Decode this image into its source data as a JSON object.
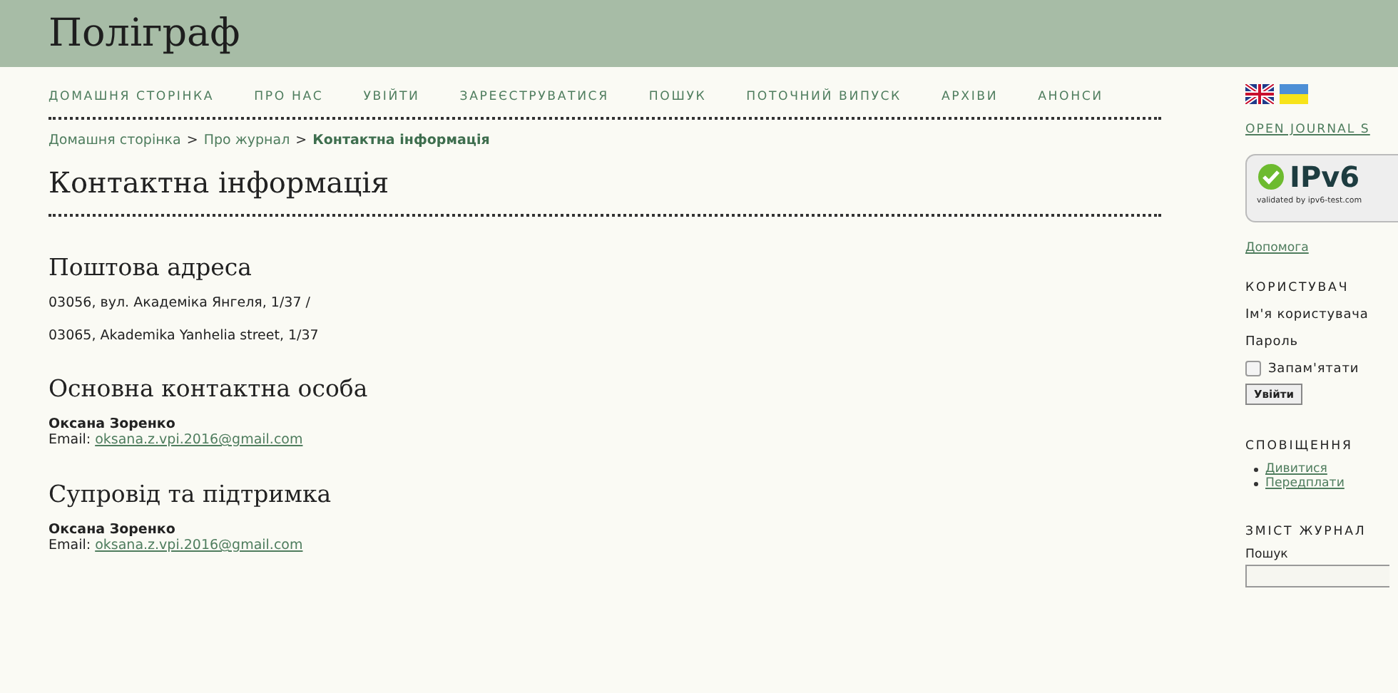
{
  "site_title": "Поліграф",
  "nav": [
    "ДОМАШНЯ СТОРІНКА",
    "ПРО НАС",
    "УВІЙТИ",
    "ЗАРЕЄСТРУВАТИСЯ",
    "ПОШУК",
    "ПОТОЧНИЙ ВИПУСК",
    "АРХІВИ",
    "АНОНСИ"
  ],
  "breadcrumb": [
    {
      "label": "Домашня сторінка",
      "current": false
    },
    {
      "label": "Про журнал",
      "current": false
    },
    {
      "label": "Контактна інформація",
      "current": true
    }
  ],
  "breadcrumb_separator": ">",
  "page_title": "Контактна інформація",
  "sections": [
    {
      "kind": "address",
      "heading": "Поштова адреса",
      "lines": [
        "03056, вул. Академіка Янгеля, 1/37 /",
        "03065, Akademika Yanhelia street, 1/37"
      ]
    },
    {
      "kind": "contact",
      "heading": "Основна контактна особа",
      "name": "Оксана Зоренко",
      "email_label": "Email:",
      "email": "oksana.z.vpi.2016@gmail.com"
    },
    {
      "kind": "contact",
      "heading": "Супровід та підтримка",
      "name": "Оксана Зоренко",
      "email_label": "Email:",
      "email": "oksana.z.vpi.2016@gmail.com"
    }
  ],
  "sidebar": {
    "ojs_link": "OPEN JOURNAL S",
    "badge": {
      "title": "IPv6",
      "caption": "validated by ipv6-test.com"
    },
    "help_link": "Допомога",
    "user": {
      "heading": "КОРИСТУВАЧ",
      "username_label": "Ім'я користувача",
      "password_label": "Пароль",
      "remember_label": "Запам'ятати",
      "remember_checked": false,
      "login_button": "Увійти"
    },
    "notifications": {
      "heading": "СПОВІЩЕННЯ",
      "links": [
        "Дивитися",
        "Передплати"
      ]
    },
    "journal_content": {
      "heading": "ЗМІСТ ЖУРНАЛ",
      "search_label": "Пошук"
    }
  }
}
